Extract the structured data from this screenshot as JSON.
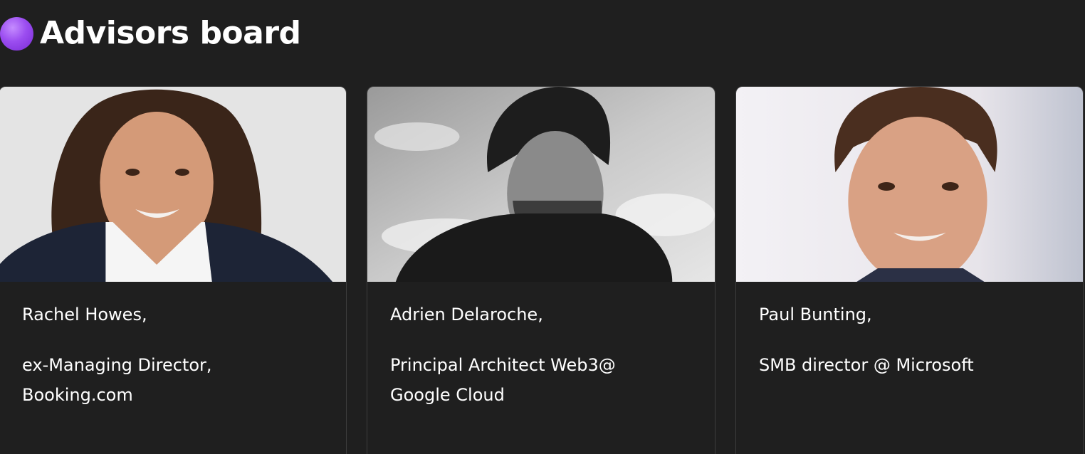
{
  "section": {
    "title": "Advisors board",
    "accent_color": "#9b4df0",
    "bullet_icon": "purple-circle-emoji"
  },
  "advisors": [
    {
      "name": "Rachel Howes,",
      "role": "ex-Managing Director, Booking.com",
      "photo_icon": "portrait-photo"
    },
    {
      "name": "Adrien Delaroche,",
      "role": "Principal Architect Web3@ Google Cloud",
      "photo_icon": "portrait-photo"
    },
    {
      "name": "Paul Bunting,",
      "role": "SMB director @ Microsoft",
      "photo_icon": "portrait-photo"
    }
  ]
}
